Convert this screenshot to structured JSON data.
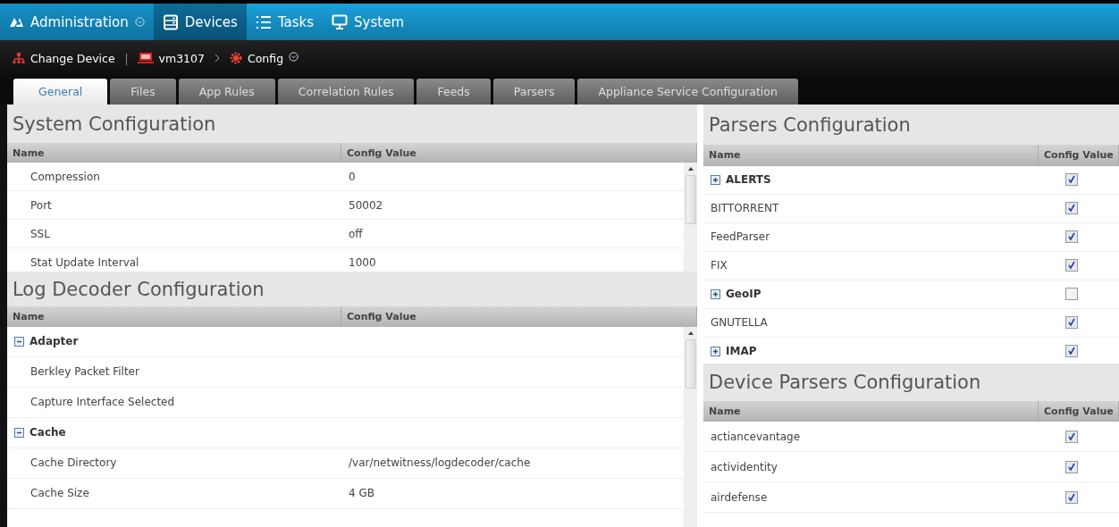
{
  "nav": {
    "items": [
      {
        "label": "Administration",
        "dropdown": true,
        "selected": false
      },
      {
        "label": "Devices",
        "dropdown": false,
        "selected": true
      },
      {
        "label": "Tasks",
        "dropdown": false,
        "selected": false
      },
      {
        "label": "System",
        "dropdown": false,
        "selected": false
      }
    ]
  },
  "breadcrumb": {
    "change_device": "Change Device",
    "device": "vm3107",
    "page": "Config"
  },
  "tabs": [
    {
      "label": "General",
      "selected": true
    },
    {
      "label": "Files",
      "selected": false
    },
    {
      "label": "App Rules",
      "selected": false
    },
    {
      "label": "Correlation Rules",
      "selected": false
    },
    {
      "label": "Feeds",
      "selected": false
    },
    {
      "label": "Parsers",
      "selected": false
    },
    {
      "label": "Appliance Service Configuration",
      "selected": false
    }
  ],
  "system_configuration": {
    "title": "System Configuration",
    "columns": [
      "Name",
      "Config Value"
    ],
    "rows": [
      {
        "name": "Compression",
        "value": "0"
      },
      {
        "name": "Port",
        "value": "50002"
      },
      {
        "name": "SSL",
        "value": "off"
      },
      {
        "name": "Stat Update Interval",
        "value": "1000"
      }
    ]
  },
  "log_decoder_configuration": {
    "title": "Log Decoder Configuration",
    "columns": [
      "Name",
      "Config Value"
    ],
    "rows": [
      {
        "kind": "group",
        "name": "Adapter",
        "expanded": true
      },
      {
        "kind": "item",
        "name": "Berkley Packet Filter"
      },
      {
        "kind": "item",
        "name": "Capture Interface Selected"
      },
      {
        "kind": "group",
        "name": "Cache",
        "expanded": true
      },
      {
        "kind": "item",
        "name": "Cache Directory",
        "value": "/var/netwitness/logdecoder/cache"
      },
      {
        "kind": "item",
        "name": "Cache Size",
        "value": "4 GB"
      }
    ]
  },
  "parsers_configuration": {
    "title": "Parsers Configuration",
    "columns": [
      "Name",
      "Config Value"
    ],
    "rows": [
      {
        "kind": "group",
        "name": "ALERTS",
        "expanded": false,
        "checked": true
      },
      {
        "kind": "item",
        "name": "BITTORRENT",
        "checked": true
      },
      {
        "kind": "item",
        "name": "FeedParser",
        "checked": true
      },
      {
        "kind": "item",
        "name": "FIX",
        "checked": true
      },
      {
        "kind": "group",
        "name": "GeoIP",
        "expanded": false,
        "checked": false
      },
      {
        "kind": "item",
        "name": "GNUTELLA",
        "checked": true
      },
      {
        "kind": "group",
        "name": "IMAP",
        "expanded": false,
        "checked": true
      }
    ]
  },
  "device_parsers_configuration": {
    "title": "Device Parsers Configuration",
    "columns": [
      "Name",
      "Config Value"
    ],
    "rows": [
      {
        "name": "actiancevantage",
        "checked": true
      },
      {
        "name": "actividentity",
        "checked": true
      },
      {
        "name": "airdefense",
        "checked": true
      }
    ]
  }
}
